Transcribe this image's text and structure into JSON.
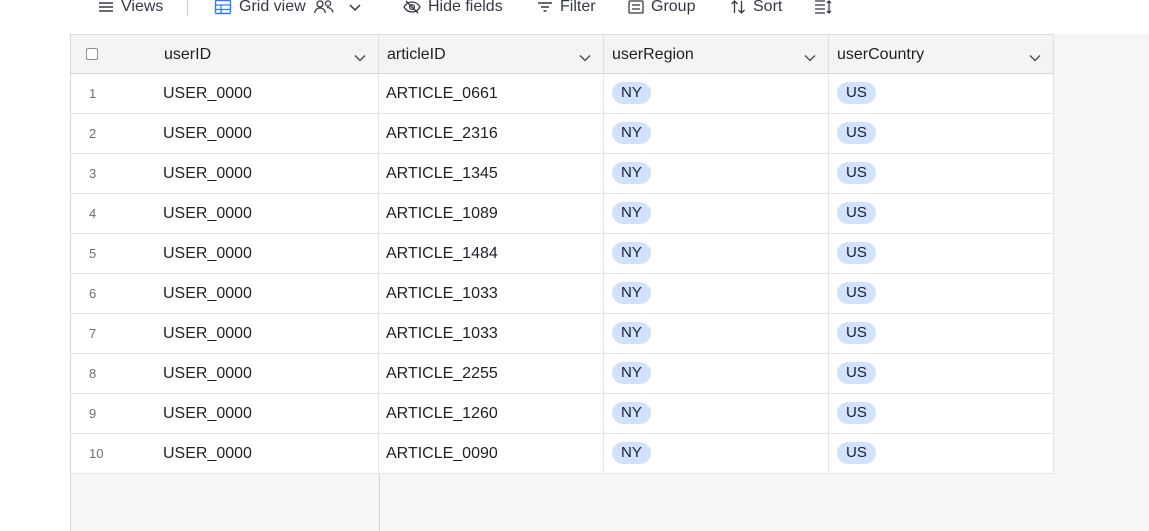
{
  "toolbar": {
    "views_label": "Views",
    "grid_view_label": "Grid view",
    "hide_fields_label": "Hide fields",
    "filter_label": "Filter",
    "group_label": "Group",
    "sort_label": "Sort"
  },
  "table": {
    "columns": [
      "userID",
      "articleID",
      "userRegion",
      "userCountry"
    ],
    "rows": [
      {
        "num": "1",
        "userID": "USER_0000",
        "articleID": "ARTICLE_0661",
        "userRegion": "NY",
        "userCountry": "US"
      },
      {
        "num": "2",
        "userID": "USER_0000",
        "articleID": "ARTICLE_2316",
        "userRegion": "NY",
        "userCountry": "US"
      },
      {
        "num": "3",
        "userID": "USER_0000",
        "articleID": "ARTICLE_1345",
        "userRegion": "NY",
        "userCountry": "US"
      },
      {
        "num": "4",
        "userID": "USER_0000",
        "articleID": "ARTICLE_1089",
        "userRegion": "NY",
        "userCountry": "US"
      },
      {
        "num": "5",
        "userID": "USER_0000",
        "articleID": "ARTICLE_1484",
        "userRegion": "NY",
        "userCountry": "US"
      },
      {
        "num": "6",
        "userID": "USER_0000",
        "articleID": "ARTICLE_1033",
        "userRegion": "NY",
        "userCountry": "US"
      },
      {
        "num": "7",
        "userID": "USER_0000",
        "articleID": "ARTICLE_1033",
        "userRegion": "NY",
        "userCountry": "US"
      },
      {
        "num": "8",
        "userID": "USER_0000",
        "articleID": "ARTICLE_2255",
        "userRegion": "NY",
        "userCountry": "US"
      },
      {
        "num": "9",
        "userID": "USER_0000",
        "articleID": "ARTICLE_1260",
        "userRegion": "NY",
        "userCountry": "US"
      },
      {
        "num": "10",
        "userID": "USER_0000",
        "articleID": "ARTICLE_0090",
        "userRegion": "NY",
        "userCountry": "US"
      }
    ]
  },
  "colors": {
    "pill_bg": "#d1e2ff",
    "accent": "#2d7ff9"
  }
}
